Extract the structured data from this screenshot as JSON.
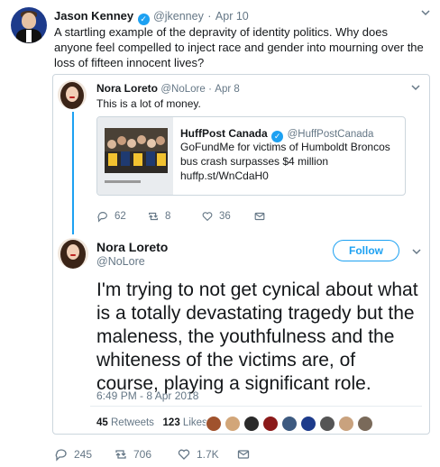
{
  "main_tweet": {
    "author_name": "Jason Kenney",
    "handle": "@jkenney",
    "dot": "·",
    "date": "Apr 10",
    "text": "A startling example of the depravity of identity politics. Why does anyone feel compelled to inject race and gender into mourning over the loss of fifteen innocent lives?",
    "actions": {
      "replies": "245",
      "retweets": "706",
      "likes": "1.7K"
    }
  },
  "quoted_reply": {
    "author_name": "Nora Loreto",
    "handle": "@NoLore",
    "dot": "·",
    "date": "Apr 8",
    "text": "This is a lot of money.",
    "card": {
      "author_name": "HuffPost Canada",
      "handle": "@HuffPostCanada",
      "text": "GoFundMe for victims of Humboldt Broncos bus crash surpasses $4 million huffp.st/WnCdaH0"
    },
    "actions": {
      "replies": "62",
      "retweets": "8",
      "likes": "36"
    }
  },
  "expanded_tweet": {
    "author_name": "Nora Loreto",
    "handle": "@NoLore",
    "follow_label": "Follow",
    "text": "I'm trying to not get cynical about what is a totally devastating tragedy but the maleness, the youthfulness and the whiteness of the victims are, of course, playing a significant role.",
    "timestamp": "6:49 PM - 8 Apr 2018",
    "retweets_count": "45",
    "retweets_label": "Retweets",
    "likes_count": "123",
    "likes_label": "Likes"
  },
  "colors": {
    "accent": "#1da1f2",
    "muted": "#657786",
    "text": "#14171a",
    "border": "#ccd6dd"
  },
  "icons": [
    "verified-icon",
    "chevron-down-icon",
    "reply-icon",
    "retweet-icon",
    "like-icon",
    "dm-icon"
  ]
}
